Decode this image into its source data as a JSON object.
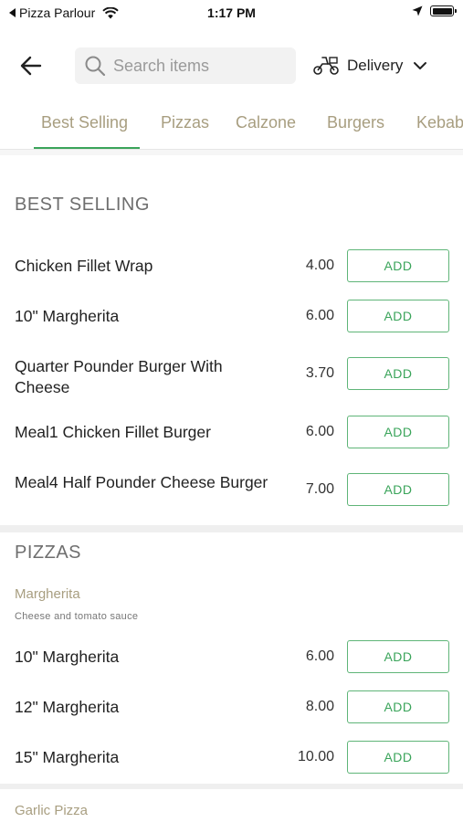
{
  "status_bar": {
    "back_app": "Pizza Parlour",
    "time": "1:17 PM"
  },
  "header": {
    "search_placeholder": "Search items",
    "delivery_label": "Delivery"
  },
  "tabs": [
    {
      "label": "Best Selling",
      "active": true
    },
    {
      "label": "Pizzas",
      "active": false
    },
    {
      "label": "Calzone",
      "active": false
    },
    {
      "label": "Burgers",
      "active": false
    },
    {
      "label": "Kebab",
      "active": false
    }
  ],
  "best_selling": {
    "title": "BEST SELLING",
    "items": [
      {
        "name": "Chicken Fillet Wrap",
        "price": "4.00",
        "add_label": "ADD"
      },
      {
        "name": "10\" Margherita",
        "price": "6.00",
        "add_label": "ADD"
      },
      {
        "name": "Quarter Pounder Burger With Cheese",
        "price": "3.70",
        "add_label": "ADD"
      },
      {
        "name": "Meal1 Chicken Fillet Burger",
        "price": "6.00",
        "add_label": "ADD"
      },
      {
        "name": "Meal4 Half Pounder Cheese Burger",
        "price": "7.00",
        "add_label": "ADD"
      }
    ]
  },
  "pizzas": {
    "title": "PIZZAS",
    "groups": [
      {
        "name": "Margherita",
        "description": "Cheese and tomato sauce",
        "items": [
          {
            "name": "10\" Margherita",
            "price": "6.00",
            "add_label": "ADD"
          },
          {
            "name": "12\" Margherita",
            "price": "8.00",
            "add_label": "ADD"
          },
          {
            "name": "15\" Margherita",
            "price": "10.00",
            "add_label": "ADD"
          }
        ]
      },
      {
        "name": "Garlic Pizza"
      }
    ]
  },
  "colors": {
    "accent_green": "#3aa45a",
    "tab_text": "#a89e80"
  }
}
